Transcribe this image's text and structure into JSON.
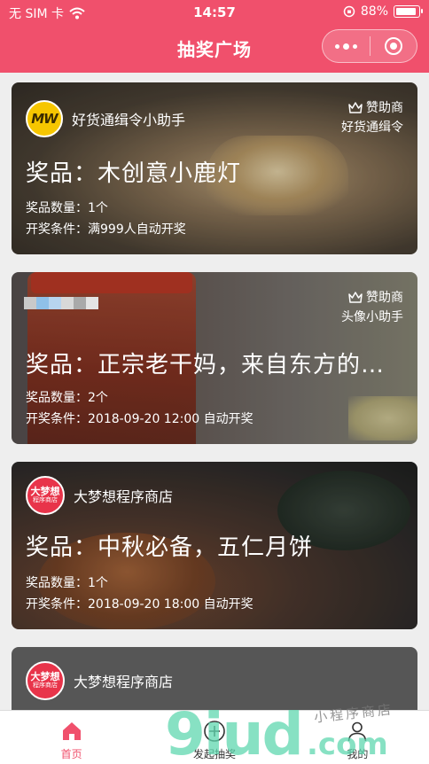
{
  "status_bar": {
    "carrier": "无 SIM 卡",
    "time": "14:57",
    "battery": "88%"
  },
  "nav": {
    "title": "抽奖广场"
  },
  "theme": {
    "accent": "#f0506c",
    "tab_active": "#f0506c"
  },
  "cards": [
    {
      "shop_name": "好货通缉令小助手",
      "logo_text": "MW",
      "sponsor_label": "赞助商",
      "sponsor_name": "好货通缉令",
      "prize": "奖品：木创意小鹿灯",
      "quantity": "奖品数量：1个",
      "condition": "开奖条件：满999人自动开奖"
    },
    {
      "shop_name": "",
      "sponsor_label": "赞助商",
      "sponsor_name": "头像小助手",
      "prize": "奖品：正宗老干妈，来自东方的神…",
      "quantity": "奖品数量：2个",
      "condition": "开奖条件：2018-09-20 12:00 自动开奖"
    },
    {
      "shop_name": "大梦想程序商店",
      "logo_text": "大梦想",
      "logo_sub": "程序商店",
      "prize": "奖品：中秋必备，五仁月饼",
      "quantity": "奖品数量：1个",
      "condition": "开奖条件：2018-09-20 18:00 自动开奖"
    },
    {
      "shop_name": "大梦想程序商店",
      "logo_text": "大梦想",
      "logo_sub": "程序商店"
    }
  ],
  "tabs": [
    {
      "label": "首页",
      "icon": "home-icon",
      "active": true
    },
    {
      "label": "发起抽奖",
      "icon": "add-circle-icon",
      "active": false
    },
    {
      "label": "我的",
      "icon": "user-icon",
      "active": false
    }
  ],
  "watermark": {
    "text": "9iud",
    "suffix": ".com",
    "small": "小程序商店"
  }
}
